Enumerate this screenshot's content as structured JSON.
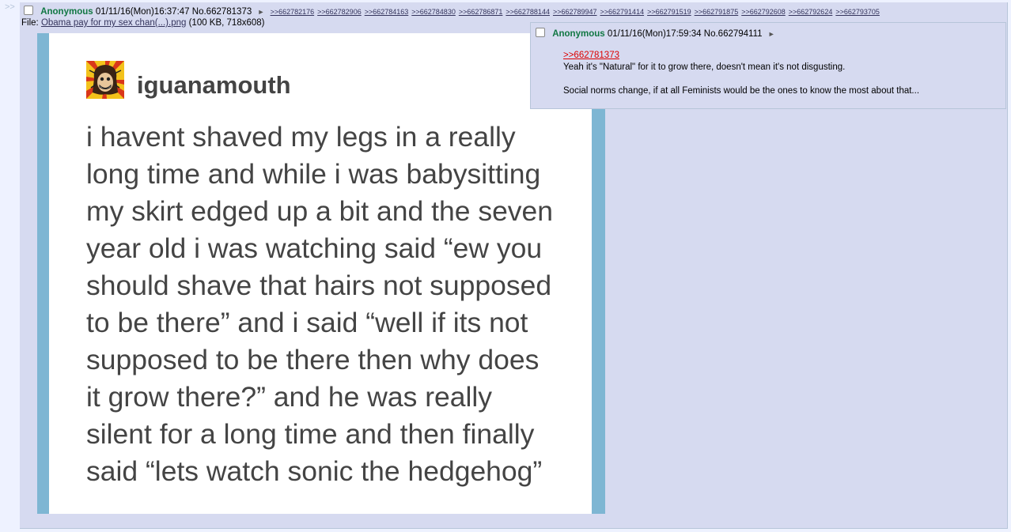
{
  "side_arrow": ">>",
  "post": {
    "name": "Anonymous",
    "datetime": "01/11/16(Mon)16:37:47",
    "number": "No.662781373",
    "backlinks": [
      ">>662782176",
      ">>662782906",
      ">>662784163",
      ">>662784830",
      ">>662786871",
      ">>662788144",
      ">>662789947",
      ">>662791414",
      ">>662791519",
      ">>662791875",
      ">>662792608",
      ">>662792624",
      ">>662793705"
    ],
    "file_label": "File:",
    "file_name": "Obama pay for my sex chan(...).png",
    "file_meta": "(100 KB, 718x608)"
  },
  "image": {
    "username": "iguanamouth",
    "text": "i havent shaved my legs in a really\nlong time and while i was babysitting\nmy skirt edged up a bit and the seven\nyear old i was watching said “ew you\nshould shave that hairs not supposed\nto be there” and i said “well if its not\nsupposed to be there then why does\nit grow there?” and he was really\nsilent for a long time and then finally\nsaid “lets watch sonic the hedgehog”"
  },
  "hover_post": {
    "name": "Anonymous",
    "datetime": "01/11/16(Mon)17:59:34",
    "number": "No.662794111",
    "quote_link": ">>662781373",
    "line1": "Yeah it's \"Natural\" for it to grow there, doesn't mean it's not disgusting.",
    "line2": "Social norms change, if at all Feminists would be the ones to know the most about that..."
  },
  "pointer_glyph": "►",
  "colors": {
    "name": "#117743",
    "post_bg": "#d6daf0",
    "frame": "#7eb6d3",
    "quote": "#dd0000"
  }
}
